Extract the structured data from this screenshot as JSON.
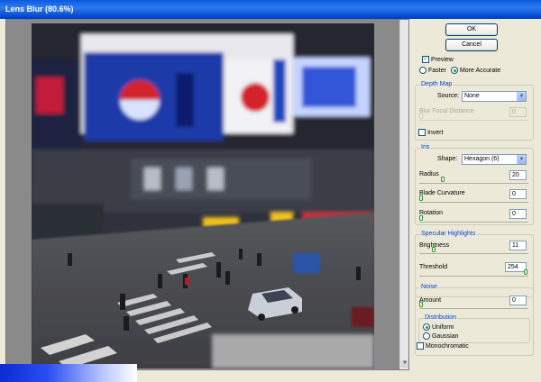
{
  "window": {
    "title": "Lens Blur (80.6%)"
  },
  "buttons": {
    "ok": "OK",
    "cancel": "Cancel"
  },
  "preview": {
    "label": "Preview",
    "checked": true,
    "faster": "Faster",
    "more_accurate": "More Accurate",
    "selected": "More Accurate"
  },
  "depth_map": {
    "title": "Depth Map",
    "source_label": "Source:",
    "source_value": "None",
    "focal_label": "Blur Focal Distance",
    "focal_value": "0",
    "invert_label": "Invert"
  },
  "iris": {
    "title": "Iris",
    "shape_label": "Shape:",
    "shape_value": "Hexagon (6)",
    "radius_label": "Radius",
    "radius_value": "20",
    "curvature_label": "Blade Curvature",
    "curvature_value": "0",
    "rotation_label": "Rotation",
    "rotation_value": "0"
  },
  "specular": {
    "title": "Specular Highlights",
    "brightness_label": "Brightness",
    "brightness_value": "11",
    "threshold_label": "Threshold",
    "threshold_value": "254"
  },
  "noise": {
    "title": "Noise",
    "amount_label": "Amount",
    "amount_value": "0",
    "distribution_title": "Distribution",
    "uniform": "Uniform",
    "gaussian": "Gaussian",
    "selected": "Uniform",
    "mono_label": "Monochromatic"
  },
  "colors": {
    "accent": "#0046d5",
    "titlebar": "#0a5ae0",
    "dialog_bg": "#ece9d8"
  }
}
